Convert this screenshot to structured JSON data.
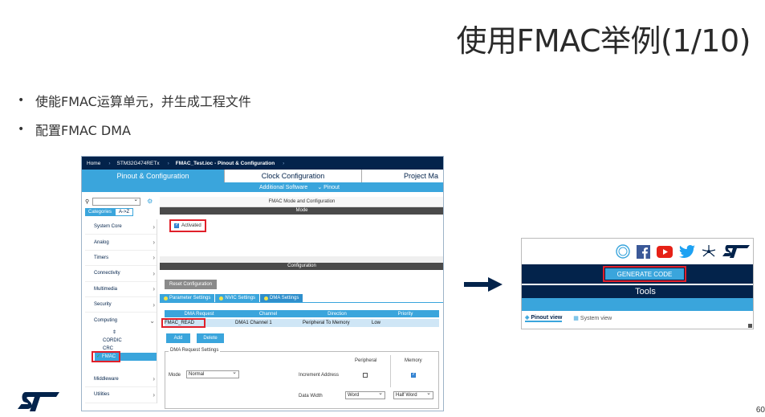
{
  "slide": {
    "title": "使用FMAC举例(1/10)",
    "bullets": [
      "使能FMAC运算单元，并生成工程文件",
      "配置FMAC DMA"
    ],
    "page_number": "60"
  },
  "cubemx": {
    "breadcrumb": [
      "Home",
      "STM32G474RETx",
      "FMAC_Test.ioc - Pinout & Configuration"
    ],
    "tabs": [
      "Pinout & Configuration",
      "Clock Configuration",
      "Project Ma"
    ],
    "subtabs": [
      "Additional Software",
      "Pinout"
    ],
    "category_tabs": [
      "Categories",
      "A->Z"
    ],
    "categories": [
      "System Core",
      "Analog",
      "Timers",
      "Connectivity",
      "Multimedia",
      "Security",
      "Computing"
    ],
    "computing_items": [
      "CORDIC",
      "CRC",
      "FMAC"
    ],
    "categories_after": [
      "Middleware",
      "Utilities"
    ],
    "mode_config_title": "FMAC Mode and Configuration",
    "mode_bar": "Mode",
    "activated_label": "Activated",
    "config_bar": "Configuration",
    "reset_button": "Reset Configuration",
    "param_tabs": [
      "Parameter Settings",
      "NVIC Settings",
      "DMA Settings"
    ],
    "dma_table": {
      "headers": [
        "DMA Request",
        "Channel",
        "Direction",
        "Priority"
      ],
      "row": [
        "FMAC_READ",
        "DMA1 Channel 1",
        "Peripheral To Memory",
        "Low"
      ]
    },
    "add_button": "Add",
    "delete_button": "Delete",
    "dma_settings": {
      "legend": "DMA Request Settings",
      "peripheral_col": "Peripheral",
      "memory_col": "Memory",
      "mode_label": "Mode",
      "mode_value": "Normal",
      "increment_label": "Increment Address",
      "data_width_label": "Data Width",
      "peripheral_width": "Word",
      "memory_width": "Half Word"
    }
  },
  "generate": {
    "button": "GENERATE CODE",
    "tools": "Tools",
    "views": [
      "Pinout view",
      "System view"
    ]
  },
  "colors": {
    "navy": "#03234b",
    "blue": "#3aa5dc",
    "highlight_red": "#e0202a"
  }
}
